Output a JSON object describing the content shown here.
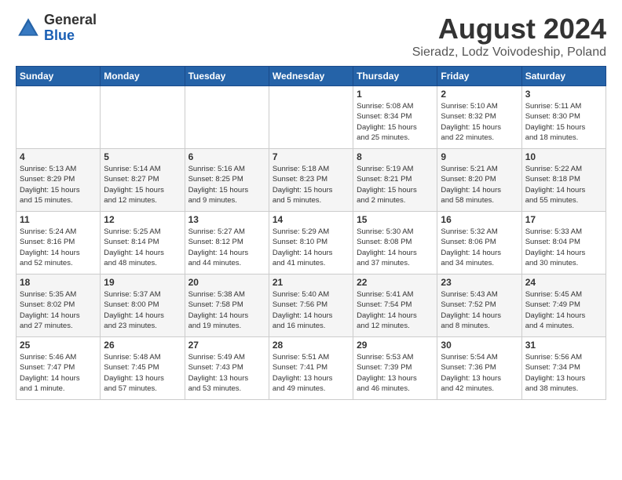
{
  "header": {
    "logo_general": "General",
    "logo_blue": "Blue",
    "title": "August 2024",
    "subtitle": "Sieradz, Lodz Voivodeship, Poland"
  },
  "days_of_week": [
    "Sunday",
    "Monday",
    "Tuesday",
    "Wednesday",
    "Thursday",
    "Friday",
    "Saturday"
  ],
  "weeks": [
    [
      {
        "num": "",
        "info": ""
      },
      {
        "num": "",
        "info": ""
      },
      {
        "num": "",
        "info": ""
      },
      {
        "num": "",
        "info": ""
      },
      {
        "num": "1",
        "info": "Sunrise: 5:08 AM\nSunset: 8:34 PM\nDaylight: 15 hours\nand 25 minutes."
      },
      {
        "num": "2",
        "info": "Sunrise: 5:10 AM\nSunset: 8:32 PM\nDaylight: 15 hours\nand 22 minutes."
      },
      {
        "num": "3",
        "info": "Sunrise: 5:11 AM\nSunset: 8:30 PM\nDaylight: 15 hours\nand 18 minutes."
      }
    ],
    [
      {
        "num": "4",
        "info": "Sunrise: 5:13 AM\nSunset: 8:29 PM\nDaylight: 15 hours\nand 15 minutes."
      },
      {
        "num": "5",
        "info": "Sunrise: 5:14 AM\nSunset: 8:27 PM\nDaylight: 15 hours\nand 12 minutes."
      },
      {
        "num": "6",
        "info": "Sunrise: 5:16 AM\nSunset: 8:25 PM\nDaylight: 15 hours\nand 9 minutes."
      },
      {
        "num": "7",
        "info": "Sunrise: 5:18 AM\nSunset: 8:23 PM\nDaylight: 15 hours\nand 5 minutes."
      },
      {
        "num": "8",
        "info": "Sunrise: 5:19 AM\nSunset: 8:21 PM\nDaylight: 15 hours\nand 2 minutes."
      },
      {
        "num": "9",
        "info": "Sunrise: 5:21 AM\nSunset: 8:20 PM\nDaylight: 14 hours\nand 58 minutes."
      },
      {
        "num": "10",
        "info": "Sunrise: 5:22 AM\nSunset: 8:18 PM\nDaylight: 14 hours\nand 55 minutes."
      }
    ],
    [
      {
        "num": "11",
        "info": "Sunrise: 5:24 AM\nSunset: 8:16 PM\nDaylight: 14 hours\nand 52 minutes."
      },
      {
        "num": "12",
        "info": "Sunrise: 5:25 AM\nSunset: 8:14 PM\nDaylight: 14 hours\nand 48 minutes."
      },
      {
        "num": "13",
        "info": "Sunrise: 5:27 AM\nSunset: 8:12 PM\nDaylight: 14 hours\nand 44 minutes."
      },
      {
        "num": "14",
        "info": "Sunrise: 5:29 AM\nSunset: 8:10 PM\nDaylight: 14 hours\nand 41 minutes."
      },
      {
        "num": "15",
        "info": "Sunrise: 5:30 AM\nSunset: 8:08 PM\nDaylight: 14 hours\nand 37 minutes."
      },
      {
        "num": "16",
        "info": "Sunrise: 5:32 AM\nSunset: 8:06 PM\nDaylight: 14 hours\nand 34 minutes."
      },
      {
        "num": "17",
        "info": "Sunrise: 5:33 AM\nSunset: 8:04 PM\nDaylight: 14 hours\nand 30 minutes."
      }
    ],
    [
      {
        "num": "18",
        "info": "Sunrise: 5:35 AM\nSunset: 8:02 PM\nDaylight: 14 hours\nand 27 minutes."
      },
      {
        "num": "19",
        "info": "Sunrise: 5:37 AM\nSunset: 8:00 PM\nDaylight: 14 hours\nand 23 minutes."
      },
      {
        "num": "20",
        "info": "Sunrise: 5:38 AM\nSunset: 7:58 PM\nDaylight: 14 hours\nand 19 minutes."
      },
      {
        "num": "21",
        "info": "Sunrise: 5:40 AM\nSunset: 7:56 PM\nDaylight: 14 hours\nand 16 minutes."
      },
      {
        "num": "22",
        "info": "Sunrise: 5:41 AM\nSunset: 7:54 PM\nDaylight: 14 hours\nand 12 minutes."
      },
      {
        "num": "23",
        "info": "Sunrise: 5:43 AM\nSunset: 7:52 PM\nDaylight: 14 hours\nand 8 minutes."
      },
      {
        "num": "24",
        "info": "Sunrise: 5:45 AM\nSunset: 7:49 PM\nDaylight: 14 hours\nand 4 minutes."
      }
    ],
    [
      {
        "num": "25",
        "info": "Sunrise: 5:46 AM\nSunset: 7:47 PM\nDaylight: 14 hours\nand 1 minute."
      },
      {
        "num": "26",
        "info": "Sunrise: 5:48 AM\nSunset: 7:45 PM\nDaylight: 13 hours\nand 57 minutes."
      },
      {
        "num": "27",
        "info": "Sunrise: 5:49 AM\nSunset: 7:43 PM\nDaylight: 13 hours\nand 53 minutes."
      },
      {
        "num": "28",
        "info": "Sunrise: 5:51 AM\nSunset: 7:41 PM\nDaylight: 13 hours\nand 49 minutes."
      },
      {
        "num": "29",
        "info": "Sunrise: 5:53 AM\nSunset: 7:39 PM\nDaylight: 13 hours\nand 46 minutes."
      },
      {
        "num": "30",
        "info": "Sunrise: 5:54 AM\nSunset: 7:36 PM\nDaylight: 13 hours\nand 42 minutes."
      },
      {
        "num": "31",
        "info": "Sunrise: 5:56 AM\nSunset: 7:34 PM\nDaylight: 13 hours\nand 38 minutes."
      }
    ]
  ]
}
